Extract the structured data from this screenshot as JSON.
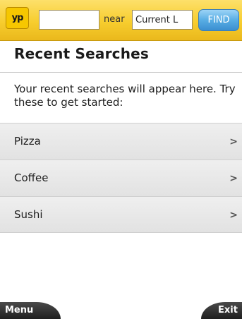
{
  "header": {
    "logo_text": "yp",
    "search_value": "",
    "near_label": "near",
    "location_value": "Current L",
    "find_label": "FIND",
    "accent_color": "#f7cd2e",
    "find_color": "#58ade4"
  },
  "main": {
    "title": "Recent Searches",
    "intro": "Your recent searches will appear here. Try these to get started:",
    "suggestions": [
      {
        "label": "Pizza",
        "icon": "chevron-right-icon"
      },
      {
        "label": "Coffee",
        "icon": "chevron-right-icon"
      },
      {
        "label": "Sushi",
        "icon": "chevron-right-icon"
      }
    ]
  },
  "softkeys": {
    "left_label": "Menu",
    "right_label": "Exit"
  }
}
